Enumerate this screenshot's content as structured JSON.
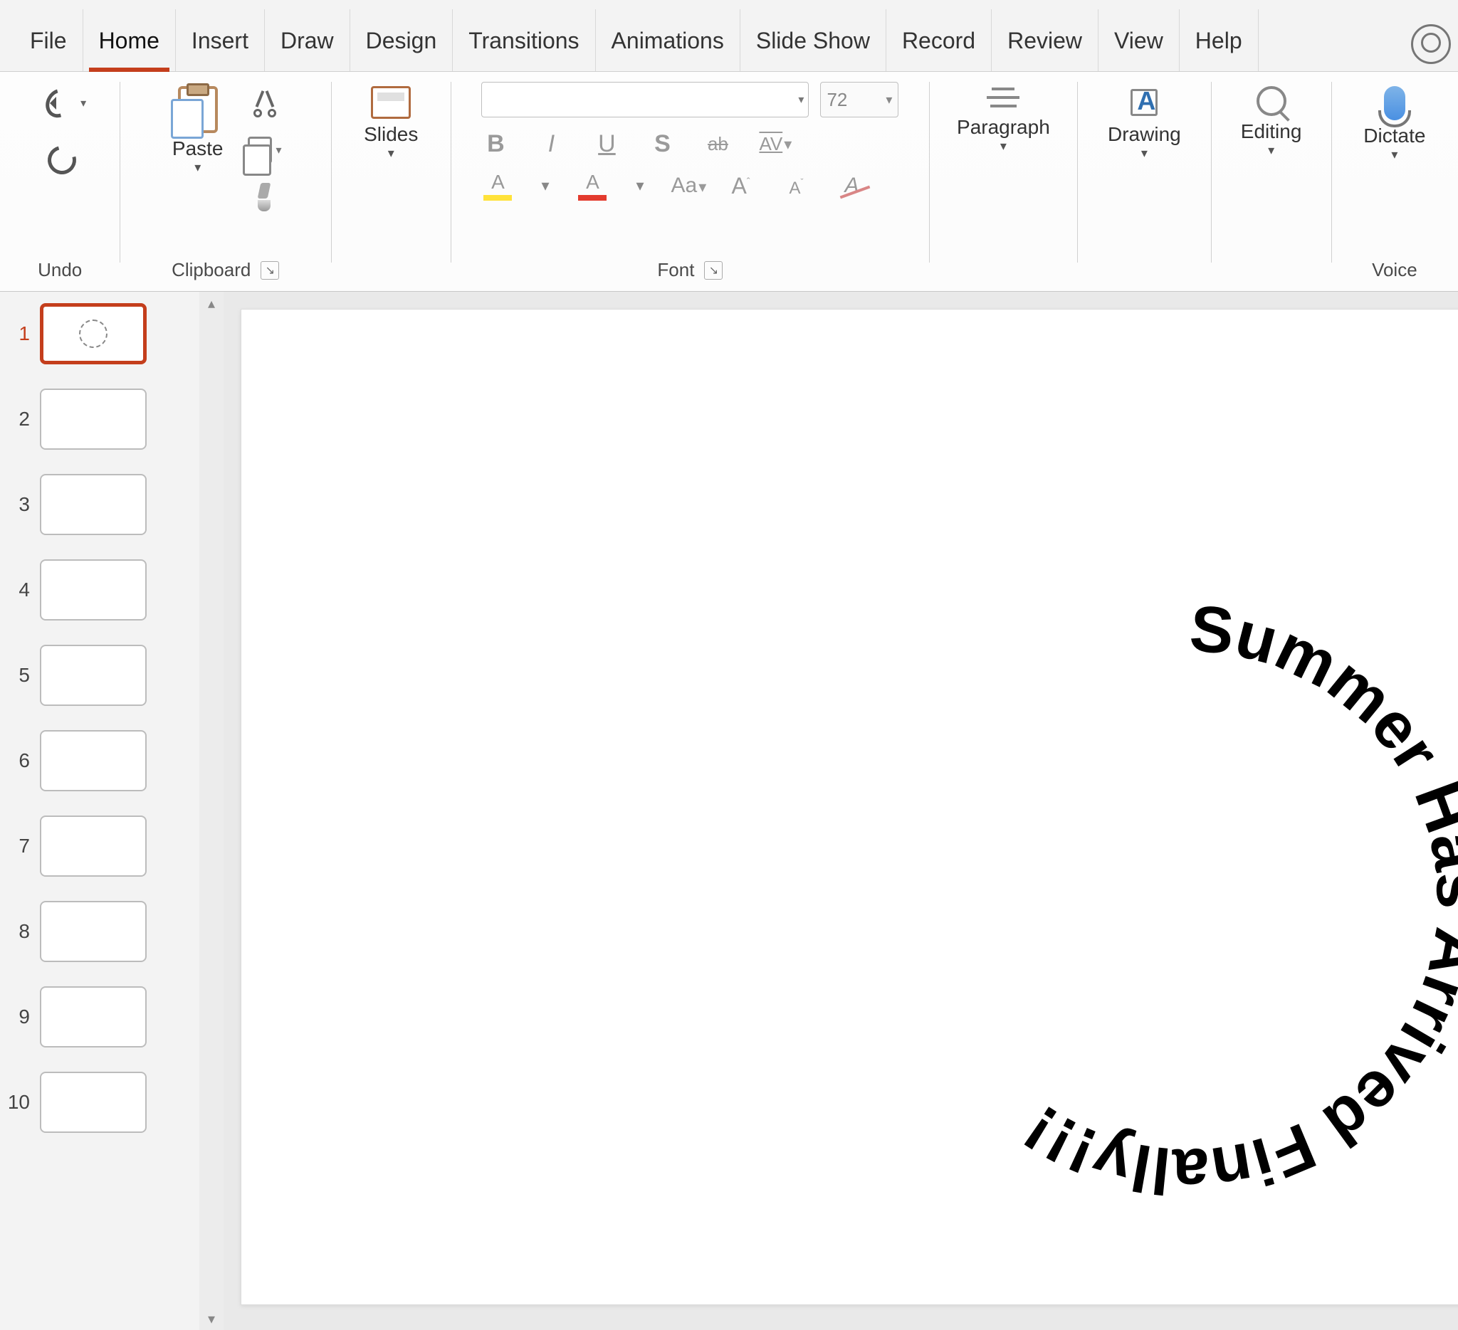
{
  "tabs": {
    "items": [
      "File",
      "Home",
      "Insert",
      "Draw",
      "Design",
      "Transitions",
      "Animations",
      "Slide Show",
      "Record",
      "Review",
      "View",
      "Help"
    ],
    "active_index": 1
  },
  "ribbon": {
    "undo": {
      "label": "Undo"
    },
    "clipboard": {
      "paste": "Paste",
      "label": "Clipboard"
    },
    "slides": {
      "btn": "Slides"
    },
    "font": {
      "label": "Font",
      "font_name": "",
      "font_size": "72",
      "bold": "B",
      "italic": "I",
      "underline": "U",
      "shadow": "S",
      "strike": "ab",
      "spacing": "AV",
      "highlight_color": "#ffe23a",
      "font_color": "#e33b2e",
      "case": "Aa",
      "grow": "A",
      "shrink": "A",
      "clear": "A"
    },
    "paragraph": {
      "label": "Paragraph"
    },
    "drawing": {
      "label": "Drawing"
    },
    "editing": {
      "label": "Editing"
    },
    "voice": {
      "btn": "Dictate",
      "label": "Voice"
    }
  },
  "slides_panel": {
    "count": 10,
    "selected": 1
  },
  "slide_content": {
    "circle_text": "Summer Has Arrived Finally!!!",
    "font_size_px": 92
  }
}
